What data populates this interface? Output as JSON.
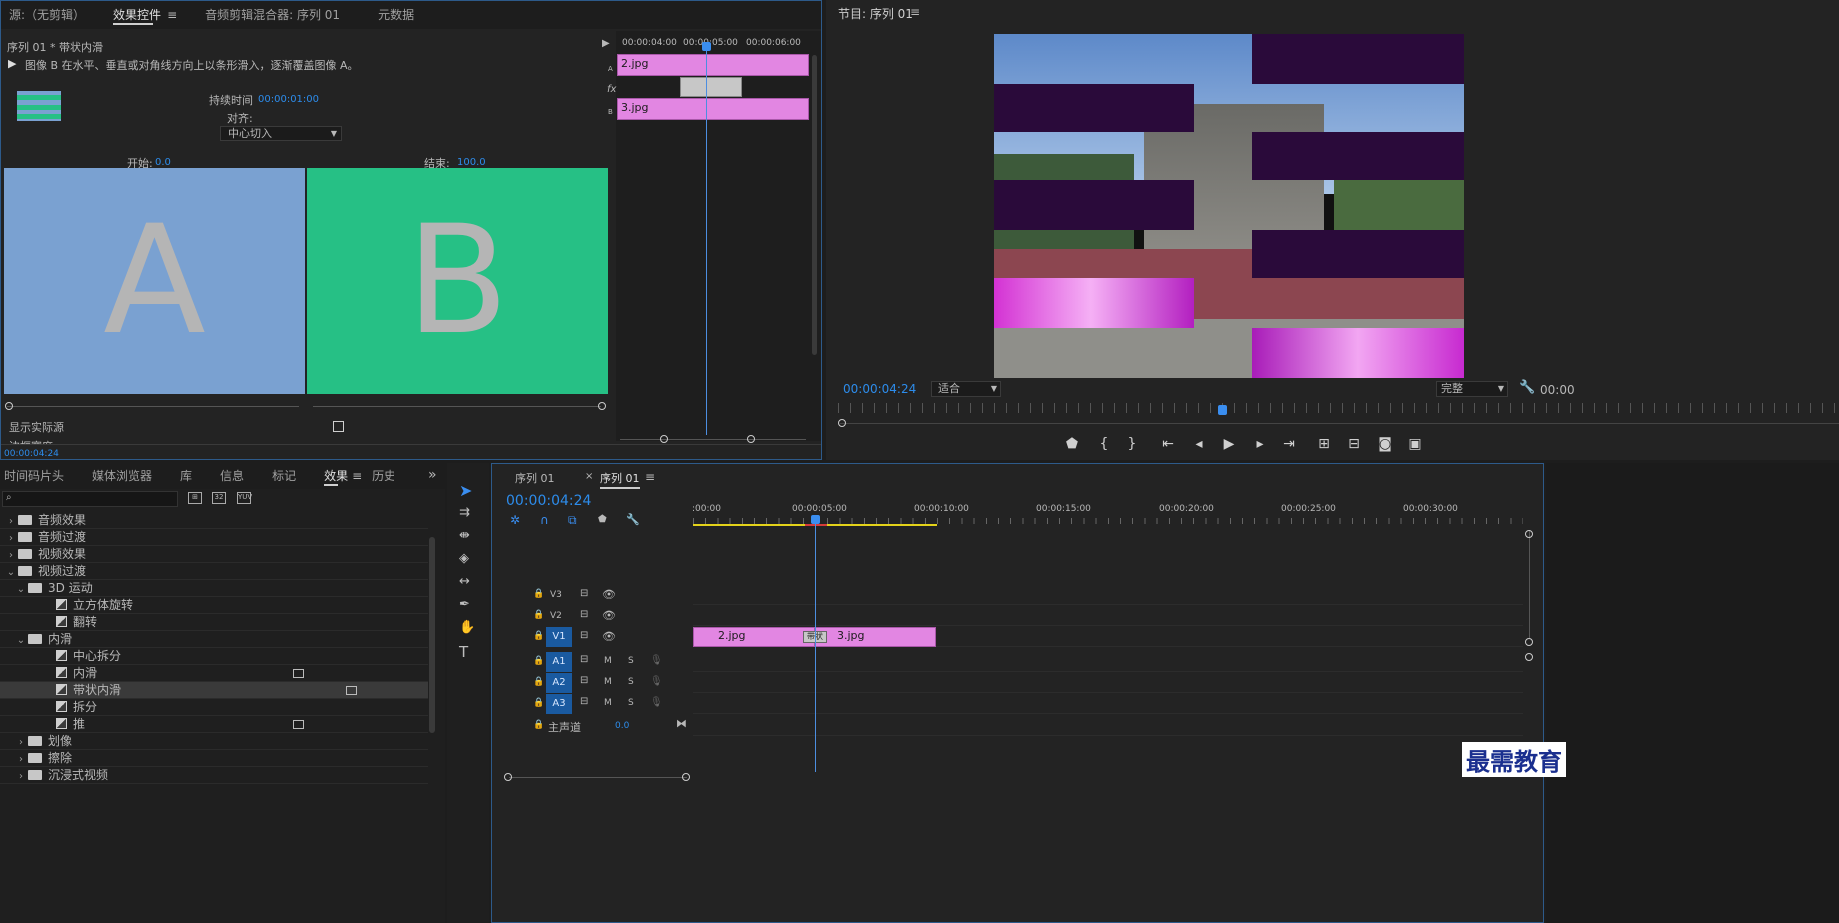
{
  "source_panel": {
    "tabs": [
      "源:（无剪辑）",
      "效果控件",
      "音频剪辑混合器: 序列 01",
      "元数据"
    ],
    "menu": "≡"
  },
  "effect_controls": {
    "header": "序列 01 * 带状内滑",
    "description": "图像 B 在水平、垂直或对角线方向上以条形滑入，逐渐覆盖图像 A。",
    "duration_label": "持续时间",
    "duration_value": "00:00:01:00",
    "align_label": "对齐:",
    "align_value": "中心切入",
    "start_label": "开始:",
    "start_value": "0.0",
    "end_label": "结束:",
    "end_value": "100.0",
    "preview_a": "A",
    "preview_b": "B",
    "show_actual_label": "显示实际源",
    "border_label": "边框宽度",
    "timecode": "00:00:04:24",
    "ruler": [
      "00:00:04:00",
      "00:00:05:00",
      "00:00:06:00"
    ],
    "clip_a": "2.jpg",
    "clip_b": "3.jpg",
    "label_a": "A",
    "label_b": "B",
    "fx": "fx",
    "colors": {
      "a": "#7aa1d1",
      "b": "#26c085",
      "clip": "#e286e2"
    }
  },
  "program_panel": {
    "title": "节目: 序列 01",
    "menu": "≡",
    "timecode": "00:00:04:24",
    "fit": "适合",
    "quality": "完整",
    "right_time": "00:00"
  },
  "project_panel": {
    "tabs": [
      "时间码片头",
      "媒体浏览器",
      "库",
      "信息",
      "标记",
      "效果",
      "历史"
    ],
    "more": "»",
    "tree": [
      {
        "label": "音频效果",
        "level": 0,
        "type": "folder",
        "open": false
      },
      {
        "label": "音频过渡",
        "level": 0,
        "type": "folder",
        "open": false
      },
      {
        "label": "视频效果",
        "level": 0,
        "type": "folder",
        "open": false
      },
      {
        "label": "视频过渡",
        "level": 0,
        "type": "folder",
        "open": true
      },
      {
        "label": "3D 运动",
        "level": 1,
        "type": "folder",
        "open": true
      },
      {
        "label": "立方体旋转",
        "level": 2,
        "type": "fx"
      },
      {
        "label": "翻转",
        "level": 2,
        "type": "fx"
      },
      {
        "label": "内滑",
        "level": 1,
        "type": "folder",
        "open": true
      },
      {
        "label": "中心拆分",
        "level": 2,
        "type": "fx"
      },
      {
        "label": "内滑",
        "level": 2,
        "type": "fx",
        "badge": true
      },
      {
        "label": "带状内滑",
        "level": 2,
        "type": "fx",
        "badge": true,
        "selected": true
      },
      {
        "label": "拆分",
        "level": 2,
        "type": "fx"
      },
      {
        "label": "推",
        "level": 2,
        "type": "fx",
        "badge": true
      },
      {
        "label": "划像",
        "level": 1,
        "type": "folder",
        "open": false
      },
      {
        "label": "擦除",
        "level": 1,
        "type": "folder",
        "open": false
      },
      {
        "label": "沉浸式视频",
        "level": 1,
        "type": "folder",
        "open": false
      }
    ]
  },
  "timeline": {
    "tabs": [
      "序列 01",
      "序列 01"
    ],
    "close": "×",
    "menu": "≡",
    "timecode": "00:00:04:24",
    "ruler": [
      ":00:00",
      "00:00:05:00",
      "00:00:10:00",
      "00:00:15:00",
      "00:00:20:00",
      "00:00:25:00",
      "00:00:30:00"
    ],
    "video_tracks": [
      "V3",
      "V2",
      "V1"
    ],
    "audio_tracks": [
      "A1",
      "A2",
      "A3"
    ],
    "master_label": "主声道",
    "master_value": "0.0",
    "m": "M",
    "s": "S",
    "clip1": "2.jpg",
    "clip2": "3.jpg",
    "transition": "带状"
  },
  "watermark": "最需教育"
}
